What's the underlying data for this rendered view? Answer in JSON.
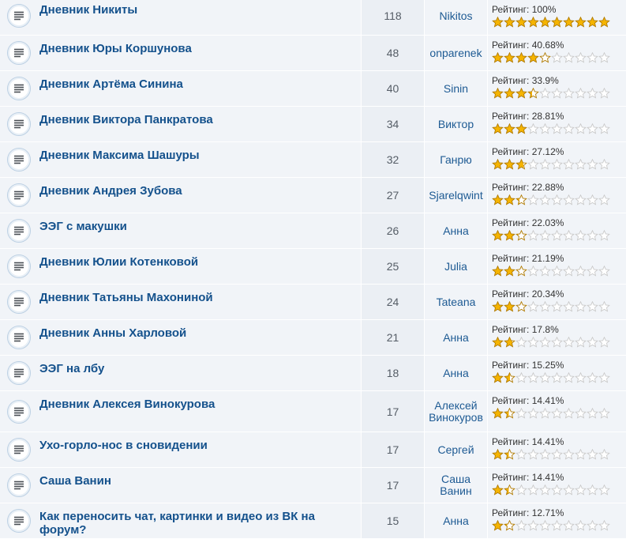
{
  "rating_prefix": "Рейтинг:",
  "icons": {
    "topic": "document-icon",
    "rating": "star-icon"
  },
  "colors": {
    "star_fill": "#f5b400",
    "star_empty": "#c9c9c9",
    "link": "#14518c"
  },
  "max_stars": 10,
  "topics": [
    {
      "title": "Дневник Никиты",
      "count": "118",
      "author": "Nikitos",
      "rating": "100%",
      "stars": 10
    },
    {
      "title": "Дневник Юры Коршунова",
      "count": "48",
      "author": "onparenek",
      "rating": "40.68%",
      "stars": 4.07
    },
    {
      "title": "Дневник Артёма Синина",
      "count": "40",
      "author": "Sinin",
      "rating": "33.9%",
      "stars": 3.39
    },
    {
      "title": "Дневник Виктора Панкратова",
      "count": "34",
      "author": "Виктор",
      "rating": "28.81%",
      "stars": 2.88
    },
    {
      "title": "Дневник Максима Шашуры",
      "count": "32",
      "author": "Ганрю",
      "rating": "27.12%",
      "stars": 2.71
    },
    {
      "title": "Дневник Андрея Зубова",
      "count": "27",
      "author": "Sjarelqwint",
      "rating": "22.88%",
      "stars": 2.29
    },
    {
      "title": "ЭЭГ с макушки",
      "count": "26",
      "author": "Анна",
      "rating": "22.03%",
      "stars": 2.2
    },
    {
      "title": "Дневник Юлии Котенковой",
      "count": "25",
      "author": "Julia",
      "rating": "21.19%",
      "stars": 2.12
    },
    {
      "title": "Дневник Татьяны Махониной",
      "count": "24",
      "author": "Tateana",
      "rating": "20.34%",
      "stars": 2.03
    },
    {
      "title": "Дневник Анны Харловой",
      "count": "21",
      "author": "Анна",
      "rating": "17.8%",
      "stars": 1.78
    },
    {
      "title": "ЭЭГ на лбу",
      "count": "18",
      "author": "Анна",
      "rating": "15.25%",
      "stars": 1.53
    },
    {
      "title": "Дневник Алексея Винокурова",
      "count": "17",
      "author": "Алексей Винокуров",
      "rating": "14.41%",
      "stars": 1.44
    },
    {
      "title": "Ухо-горло-нос в сновидении",
      "count": "17",
      "author": "Сергей",
      "rating": "14.41%",
      "stars": 1.44
    },
    {
      "title": "Саша Ванин",
      "count": "17",
      "author": "Саша Ванин",
      "rating": "14.41%",
      "stars": 1.44
    },
    {
      "title": "Как переносить чат, картинки и видео из ВК на форум?",
      "count": "15",
      "author": "Анна",
      "rating": "12.71%",
      "stars": 1.27
    }
  ]
}
